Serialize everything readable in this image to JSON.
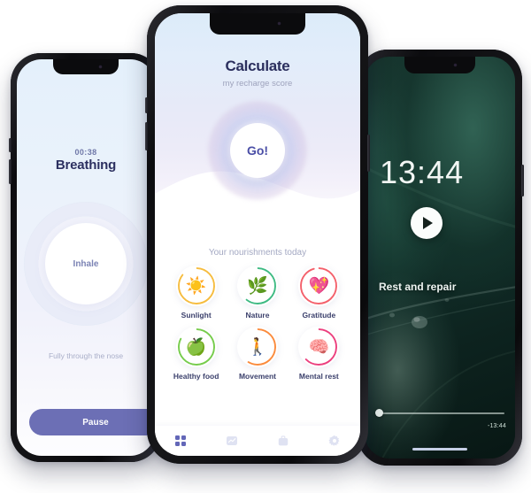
{
  "scene": {
    "description": "Three smartphone mockups of a wellness app",
    "background_color": "#ffffff"
  },
  "phone_left": {
    "name": "Breathing screen",
    "timer": "00:38",
    "title": "Breathing",
    "circle_label": "Inhale",
    "hint": "Fully through the nose",
    "button_label": "Pause",
    "button_color": "#6c6fb5",
    "background_color": "#e8f1fb"
  },
  "phone_center": {
    "name": "Calculate recharge score screen",
    "title": "Calculate",
    "subtitle": "my recharge score",
    "go_button_label": "Go!",
    "section_title": "Your nourishments today",
    "nourishments": [
      {
        "label": "Sunlight",
        "icon": "sun-icon",
        "glyph": "☀️",
        "color": "#f6bc3e",
        "progress": 85
      },
      {
        "label": "Nature",
        "icon": "leaf-icon",
        "glyph": "🌿",
        "color": "#3dba82",
        "progress": 60
      },
      {
        "label": "Gratitude",
        "icon": "heart-icon",
        "glyph": "💖",
        "color": "#f4606b",
        "progress": 95
      },
      {
        "label": "Healthy food",
        "icon": "apple-icon",
        "glyph": "🍏",
        "color": "#76cc4b",
        "progress": 82
      },
      {
        "label": "Movement",
        "icon": "walking-icon",
        "glyph": "🚶",
        "color": "#fb8b3c",
        "progress": 58
      },
      {
        "label": "Mental rest",
        "icon": "brain-rest-icon",
        "glyph": "🧠",
        "color": "#ec3f7e",
        "progress": 62
      }
    ],
    "tabs": [
      {
        "name": "tab-dashboard",
        "icon": "grid-icon",
        "active": true
      },
      {
        "name": "tab-stats",
        "icon": "chart-icon",
        "active": false
      },
      {
        "name": "tab-toolbox",
        "icon": "briefcase-icon",
        "active": false
      },
      {
        "name": "tab-settings",
        "icon": "gear-icon",
        "active": false
      }
    ],
    "accent_color": "#4a4ea6"
  },
  "phone_right": {
    "name": "Rest and repair player screen",
    "clock": "13:44",
    "caption": "Rest and repair",
    "play_icon": "play-icon",
    "remaining_time": "-13:44",
    "progress_percent": 2,
    "background": "dark green leaf photo"
  }
}
